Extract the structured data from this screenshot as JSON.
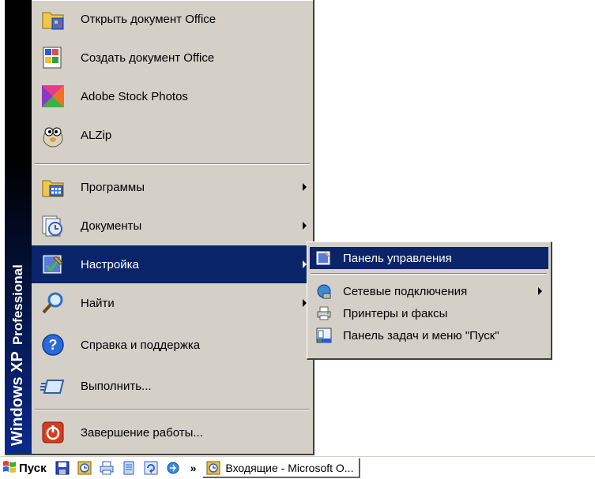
{
  "side_banner": {
    "brand": "Windows XP",
    "edition": "Professional"
  },
  "menu_items": [
    {
      "label": "Открыть документ Office",
      "icon": "open-office-document-icon"
    },
    {
      "label": "Создать документ Office",
      "icon": "new-office-document-icon"
    },
    {
      "label": "Adobe Stock Photos",
      "icon": "adobe-stock-photos-icon"
    },
    {
      "label": "ALZip",
      "icon": "alzip-icon"
    },
    {
      "label": "Программы",
      "icon": "programs-folder-icon",
      "has_submenu": true
    },
    {
      "label": "Документы",
      "icon": "documents-icon",
      "has_submenu": true
    },
    {
      "label": "Настройка",
      "icon": "settings-icon",
      "has_submenu": true,
      "highlighted": true
    },
    {
      "label": "Найти",
      "icon": "search-icon",
      "has_submenu": true
    },
    {
      "label": "Справка и поддержка",
      "icon": "help-icon"
    },
    {
      "label": "Выполнить...",
      "icon": "run-icon"
    },
    {
      "label": "Завершение работы...",
      "icon": "shutdown-icon"
    }
  ],
  "submenu": {
    "items": [
      {
        "label": "Панель управления",
        "icon": "control-panel-icon",
        "highlighted": true
      },
      {
        "label": "Сетевые подключения",
        "icon": "network-connections-icon",
        "has_submenu": true
      },
      {
        "label": "Принтеры и факсы",
        "icon": "printers-faxes-icon"
      },
      {
        "label": "Панель задач и меню \"Пуск\"",
        "icon": "taskbar-start-menu-icon"
      }
    ]
  },
  "taskbar": {
    "start_label": "Пуск",
    "quick_launch": [
      "save-icon",
      "outlook-icon",
      "print-icon",
      "notes-icon",
      "refresh-icon",
      "ie-icon"
    ],
    "more_label": "»",
    "task_label": "Входящие - Microsoft O..."
  },
  "colors": {
    "menu_background": "#d4d0c8",
    "highlight": "#0a246a",
    "banner_top": "#000000",
    "banner_bottom": "#0a2a8c"
  }
}
